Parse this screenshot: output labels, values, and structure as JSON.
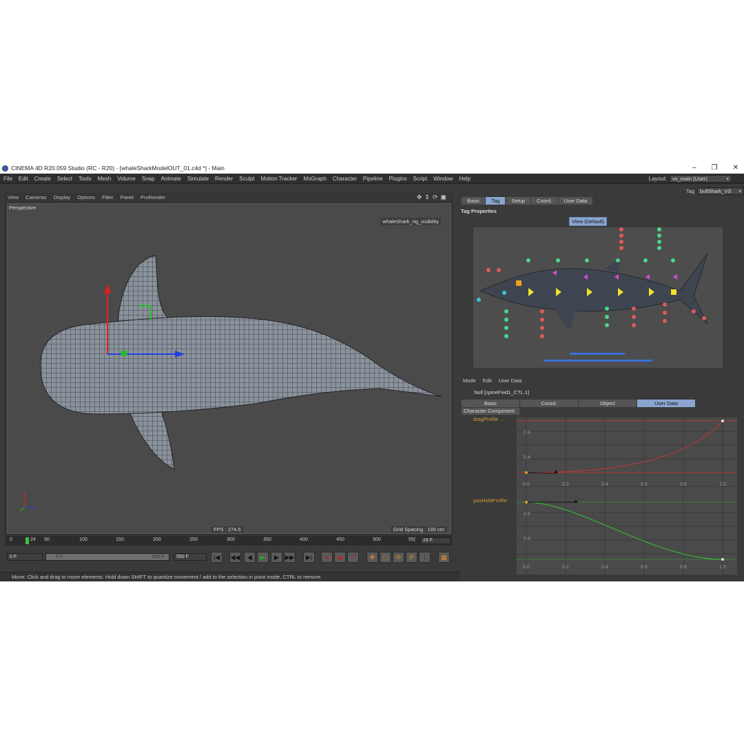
{
  "window": {
    "title": "CINEMA 4D R20.059 Studio (RC - R20) - [whaleSharkModelOUT_01.c4d *] - Main",
    "minimize": "–",
    "restore": "❐",
    "close": "✕"
  },
  "menu": [
    "File",
    "Edit",
    "Create",
    "Select",
    "Tools",
    "Mesh",
    "Volume",
    "Snap",
    "Animate",
    "Simulate",
    "Render",
    "Sculpt",
    "Motion Tracker",
    "MoGraph",
    "Character",
    "Pipeline",
    "Plugins",
    "Script",
    "Window",
    "Help"
  ],
  "layout": {
    "label": "Layout:",
    "value": "vs_main (User)"
  },
  "viewport": {
    "menu": [
      "View",
      "Cameras",
      "Display",
      "Options",
      "Filter",
      "Panel",
      "ProRender"
    ],
    "camera": "Perspective",
    "badge": "whaleShark_rig_visibility",
    "fps": "FPS : 274.5",
    "grid_spacing": "Grid Spacing : 100 cm"
  },
  "timeline": {
    "ticks": [
      "0",
      "24",
      "50",
      "100",
      "150",
      "200",
      "250",
      "300",
      "350",
      "400",
      "450",
      "500",
      "55("
    ],
    "fps_field": "24 F",
    "current_frame": 24,
    "start_field": "0 F",
    "range_left": "0 F",
    "range_right": "550 F",
    "end_field": "550 F"
  },
  "status": "Move: Click and drag to move elements. Hold down SHIFT to quantize movement / add to the selection in point mode, CTRL to remove.",
  "attributes_top": {
    "tag_label": "Tag",
    "tag_value": "bullShark_VS",
    "tabs": [
      "Basic",
      "Tag",
      "Setup",
      "Coord.",
      "User Data"
    ],
    "active_tab": "Tag",
    "section": "Tag Properties",
    "view_button": "View (Default)"
  },
  "attributes_bottom": {
    "menu": [
      "Mode",
      "Edit",
      "User Data"
    ],
    "object": "Null [spineFwd1_CTL.1]",
    "tabs": [
      "Basic",
      "Coord.",
      "Object",
      "User Data"
    ],
    "active_tab": "User Data",
    "group": "Character Component",
    "curves": [
      {
        "label": "dragProfile . . .",
        "color": "#cc3333",
        "y_ticks": [
          "0.8",
          "0.4"
        ],
        "x_ticks": [
          "0.0",
          "0.2",
          "0.4",
          "0.6",
          "0.8",
          "1.0"
        ]
      },
      {
        "label": "posHoldProfile",
        "color": "#33cc33",
        "y_ticks": [
          "0.8",
          "0.4"
        ],
        "x_ticks": [
          "0.0",
          "0.2",
          "0.4",
          "0.6",
          "0.8",
          "1.0"
        ]
      }
    ]
  }
}
